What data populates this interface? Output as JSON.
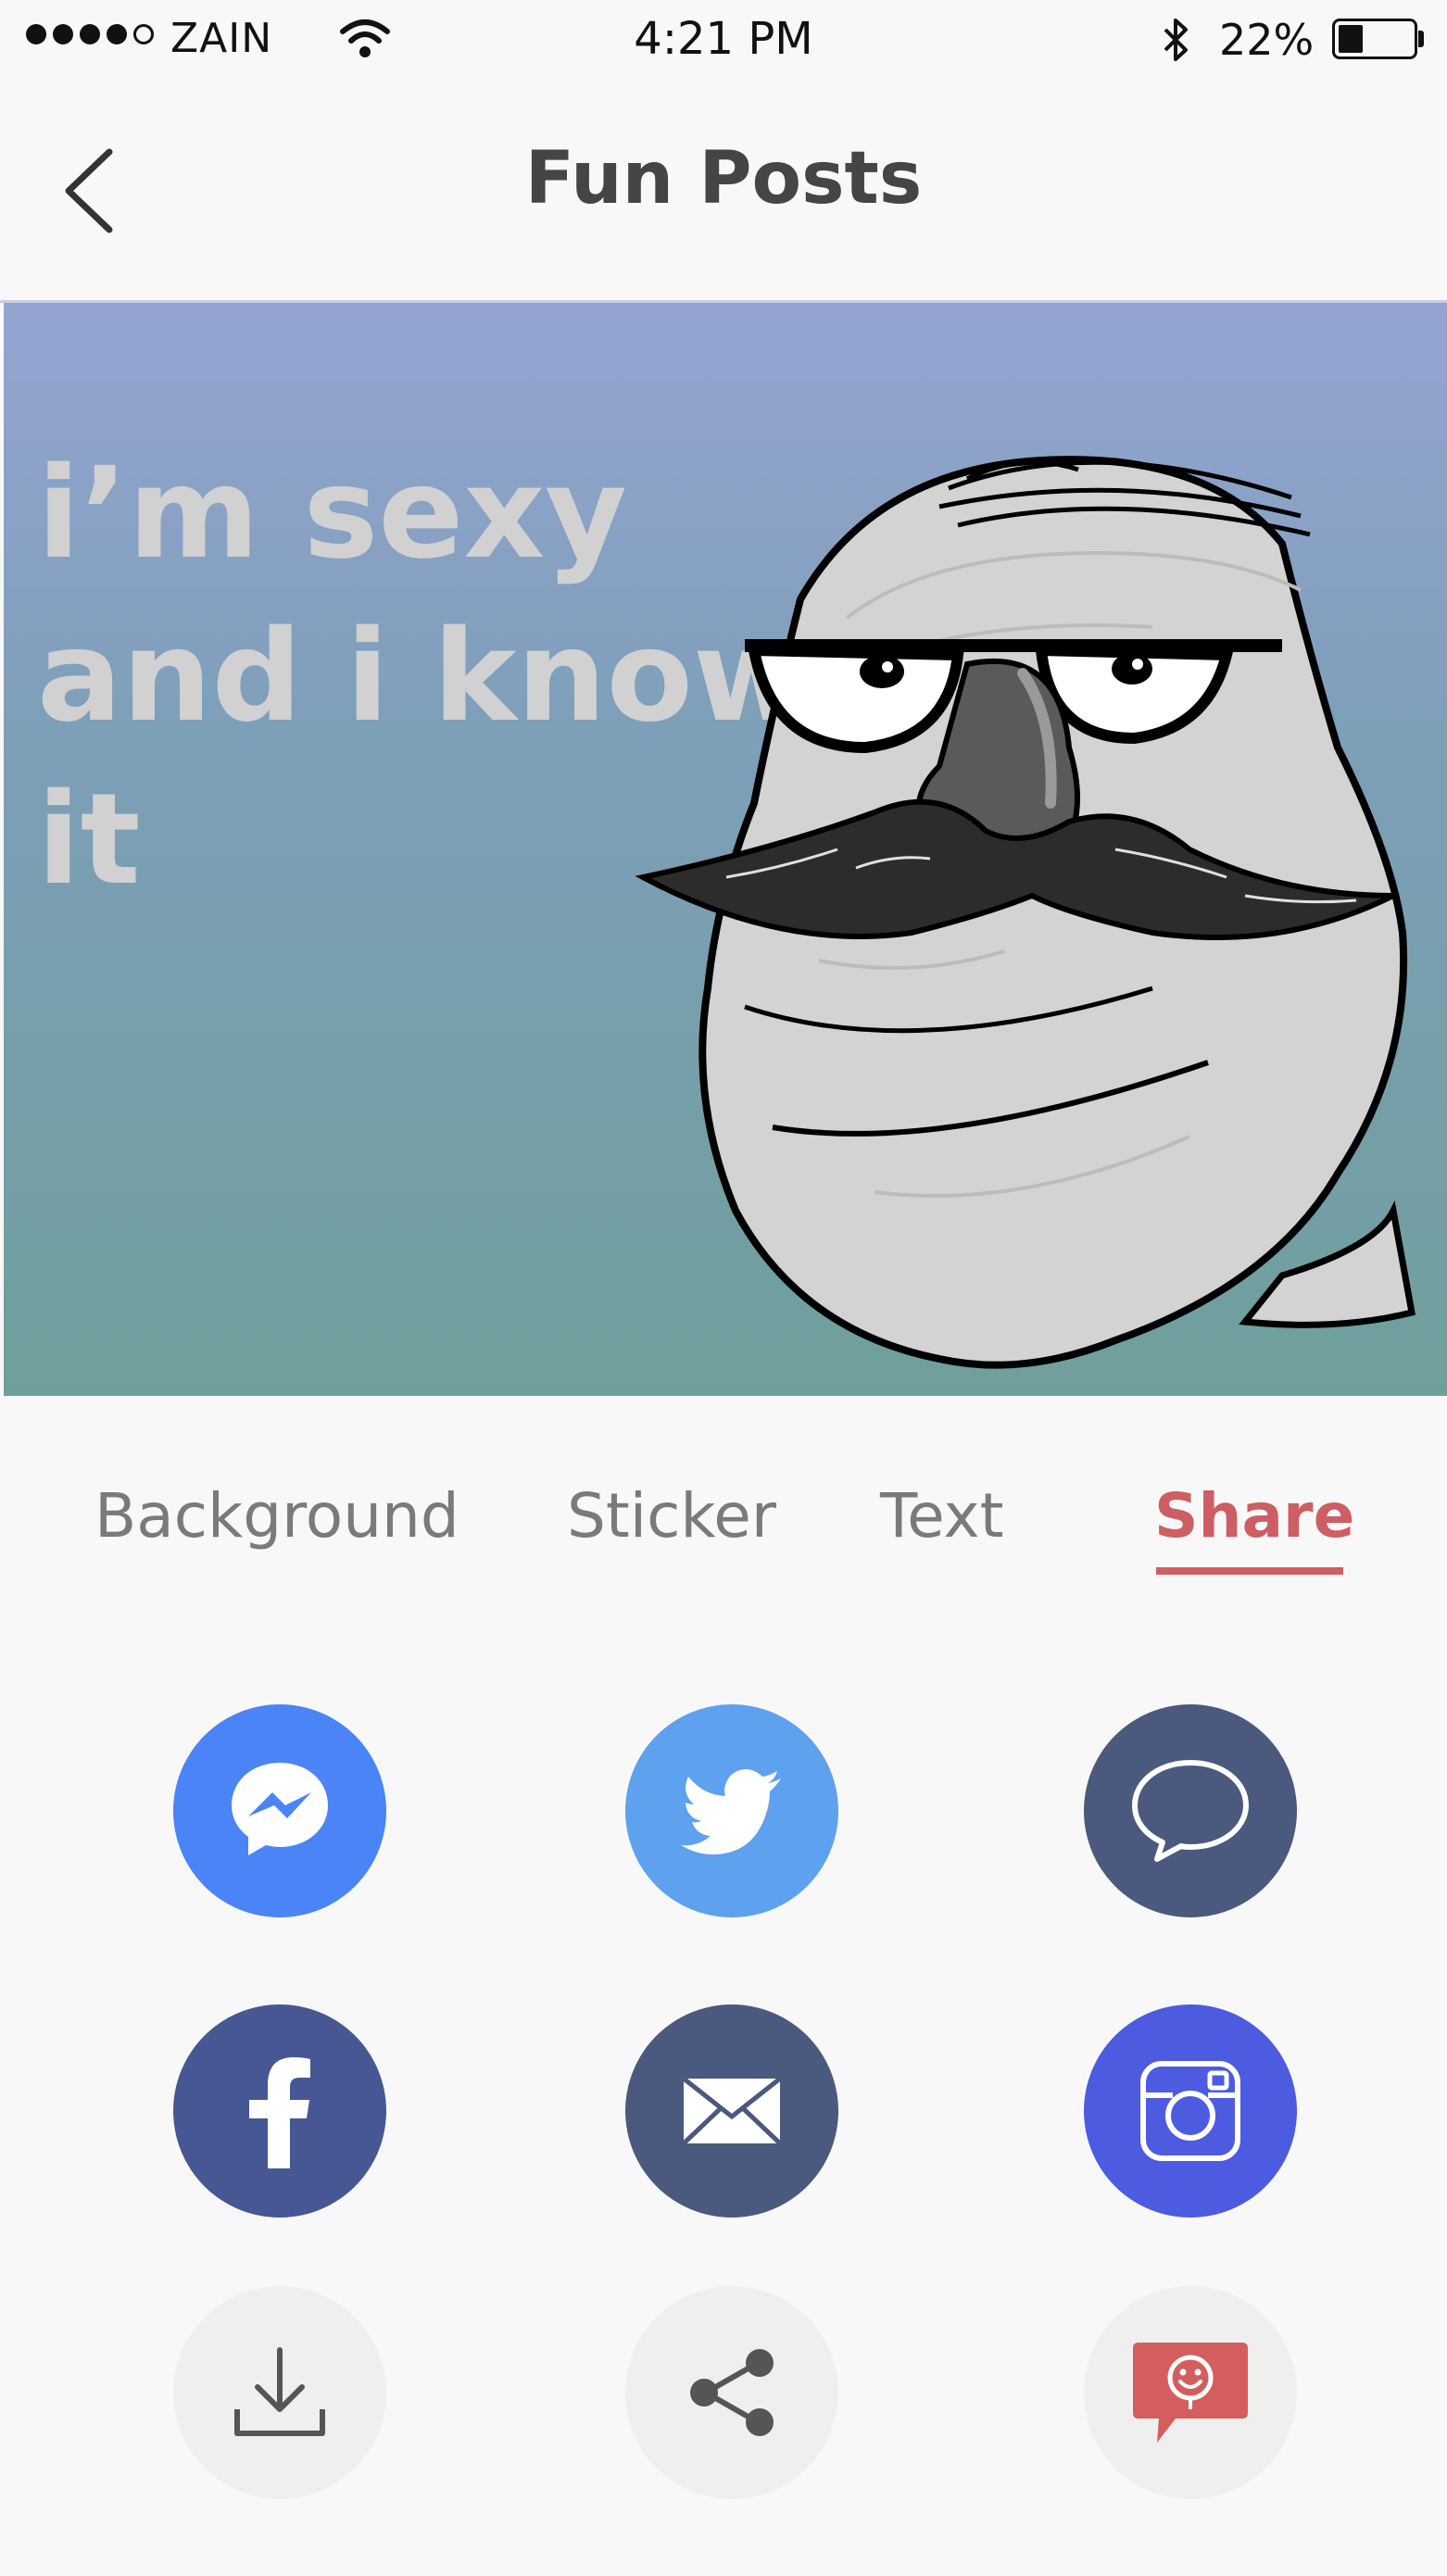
{
  "status_bar": {
    "carrier": "ZAIN",
    "time": "4:21 PM",
    "battery_percent": "22%",
    "battery_level": 0.22,
    "signal_bars_filled": 4,
    "signal_bars_total": 5
  },
  "nav": {
    "title": "Fun Posts",
    "back_icon": "chevron-left-icon"
  },
  "post": {
    "text": "i’m sexy\nand i know\nit",
    "background_gradient": [
      "#95a4d2",
      "#6f9f9c"
    ],
    "text_color": "#d1d1d1",
    "sticker": "mustache-guy-sticker"
  },
  "tabs": [
    {
      "label": "Background",
      "active": false
    },
    {
      "label": "Sticker",
      "active": false
    },
    {
      "label": "Text",
      "active": false
    },
    {
      "label": "Share",
      "active": true
    }
  ],
  "accent_color": "#cd5e63",
  "share_options": [
    {
      "icon": "messenger-icon",
      "color": "#4a84f6"
    },
    {
      "icon": "twitter-icon",
      "color": "#5ea1ee"
    },
    {
      "icon": "message-bubble-icon",
      "color": "#4a597d"
    },
    {
      "icon": "facebook-icon",
      "color": "#465794"
    },
    {
      "icon": "mail-icon",
      "color": "#4a597d"
    },
    {
      "icon": "instagram-icon",
      "color": "#4c5be0"
    },
    {
      "icon": "download-icon",
      "color": "#efefef"
    },
    {
      "icon": "share-icon",
      "color": "#efefef"
    },
    {
      "icon": "sticker-chat-icon",
      "color": "#efefef"
    }
  ]
}
